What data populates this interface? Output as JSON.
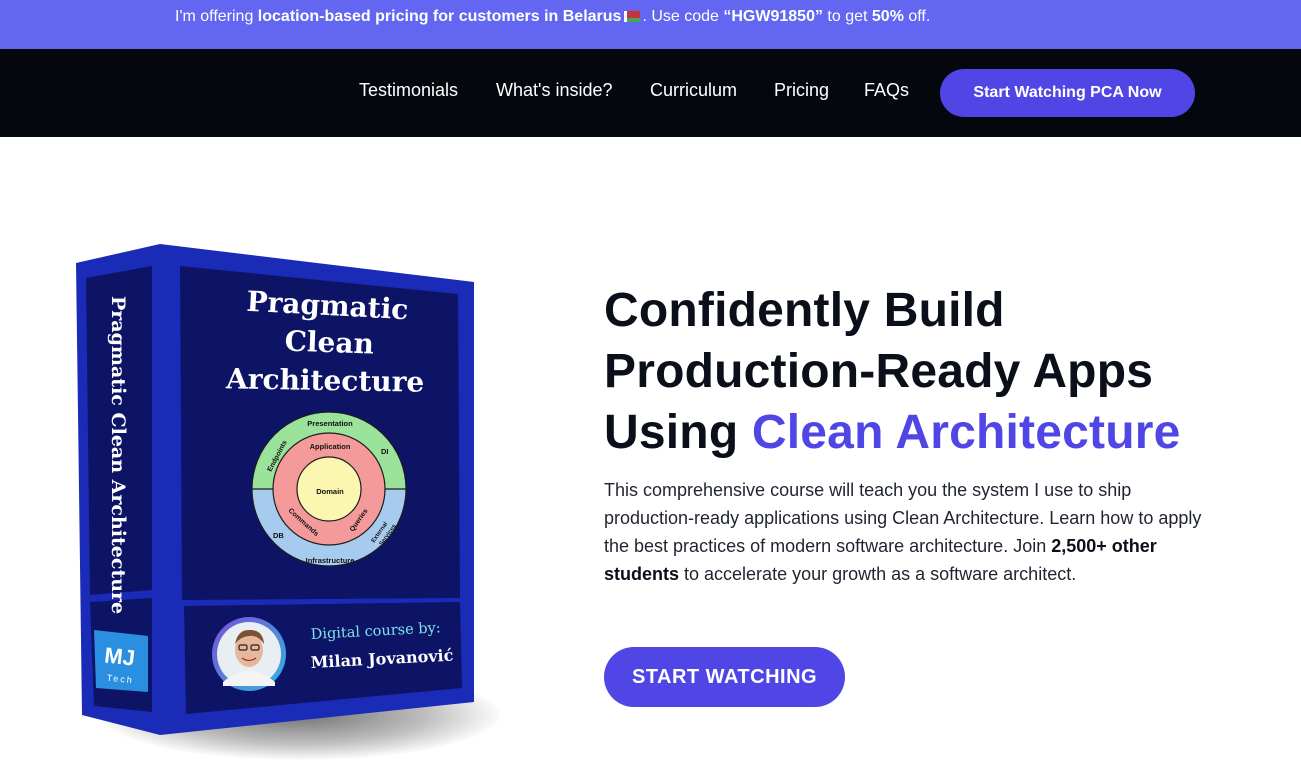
{
  "promo": {
    "part1": "I'm offering ",
    "bold1": "location-based pricing for customers in Belarus",
    "part2": ". Use code ",
    "code": "“HGW91850”",
    "part3": " to get ",
    "discount": "50%",
    "part4": " off."
  },
  "nav": {
    "links": [
      "Testimonials",
      "What's inside?",
      "Curriculum",
      "Pricing",
      "FAQs"
    ],
    "cta": "Start Watching PCA Now"
  },
  "product_box": {
    "title_line1": "Pragmatic",
    "title_line2": "Clean",
    "title_line3": "Architecture",
    "spine_title": "Pragmatic Clean Architecture",
    "diagram": {
      "presentation": "Presentation",
      "application": "Application",
      "domain": "Domain",
      "infrastructure": "Infrastructure",
      "endpoints": "Endpoints",
      "di": "DI",
      "commands": "Commands",
      "queries": "Queries",
      "db": "DB",
      "external_services_1": "External",
      "external_services_2": "Services"
    },
    "byline": "Digital course by:",
    "author": "Milan Jovanović",
    "logo_main": "MJ",
    "logo_sub": "Tech"
  },
  "hero": {
    "title_line1": "Confidently Build",
    "title_line2": "Production-Ready Apps",
    "title_prefix": "Using ",
    "title_accent": "Clean Architecture",
    "desc_part1": "This comprehensive course will teach you the system I use to ship production-ready applications using Clean Architecture. Learn how to apply the best practices of modern software architecture. Join ",
    "desc_bold": "2,500+ other students",
    "desc_part2": " to accelerate your growth as a software architect.",
    "cta": "START WATCHING"
  },
  "colors": {
    "promo_bg": "#6366f1",
    "nav_bg": "#05070f",
    "accent": "#4f46e5",
    "box_blue": "#1a2bb8",
    "box_panel": "#0d1466"
  }
}
